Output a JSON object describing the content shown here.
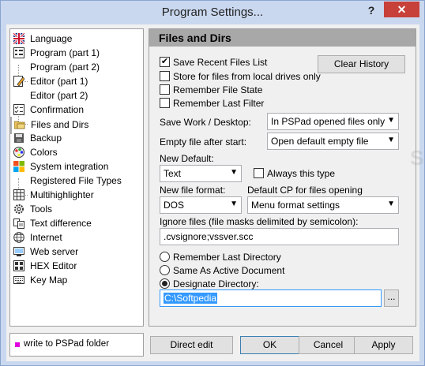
{
  "window": {
    "title": "Program Settings...",
    "help": "?",
    "close": "✕"
  },
  "tree": {
    "items": [
      {
        "label": "Language",
        "icon": "uk-flag-icon"
      },
      {
        "label": "Program  (part 1)",
        "icon": "form-icon"
      },
      {
        "label": "Program  (part 2)",
        "icon": ""
      },
      {
        "label": "Editor  (part 1)",
        "icon": "pencil-icon"
      },
      {
        "label": "Editor  (part 2)",
        "icon": ""
      },
      {
        "label": "Confirmation",
        "icon": "checklist-icon"
      },
      {
        "label": "Files and Dirs",
        "icon": "folder-icon"
      },
      {
        "label": "Backup",
        "icon": "backup-icon"
      },
      {
        "label": "Colors",
        "icon": "palette-icon"
      },
      {
        "label": "System integration",
        "icon": "windows-icon"
      },
      {
        "label": "Registered File Types",
        "icon": ""
      },
      {
        "label": "Multihighlighter",
        "icon": "grid-icon"
      },
      {
        "label": "Tools",
        "icon": "gear-icon"
      },
      {
        "label": "Text difference",
        "icon": "diff-icon"
      },
      {
        "label": "Internet",
        "icon": "globe-icon"
      },
      {
        "label": "Web server",
        "icon": "server-icon"
      },
      {
        "label": "HEX Editor",
        "icon": "hex-icon"
      },
      {
        "label": "Key Map",
        "icon": "keyboard-icon"
      }
    ]
  },
  "legend": {
    "text": "write to PSPad folder",
    "color": "#e000e0"
  },
  "panel": {
    "heading": "Files and Dirs",
    "checks": [
      {
        "label": "Save Recent Files List",
        "checked": "✔"
      },
      {
        "label": "Store for files from local drives only",
        "checked": ""
      },
      {
        "label": "Remember File State",
        "checked": ""
      },
      {
        "label": "Remember Last Filter",
        "checked": ""
      }
    ],
    "clear_history": "Clear History",
    "save_work_label": "Save Work / Desktop:",
    "save_work_value": "In PSPad opened files only",
    "empty_file_label": "Empty file after start:",
    "empty_file_value": "Open default empty file",
    "new_default_label": "New Default:",
    "new_default_value": "Text",
    "always_type": "Always this type",
    "new_format_label": "New file format:",
    "new_format_value": "DOS",
    "default_cp_label": "Default CP for files opening",
    "default_cp_value": "Menu format settings",
    "ignore_label": "Ignore files (file masks delimited by semicolon):",
    "ignore_value": ".cvsignore;vssver.scc",
    "radios": [
      {
        "label": "Remember Last Directory",
        "selected": false
      },
      {
        "label": "Same As Active Document",
        "selected": false
      },
      {
        "label": "Designate Directory:",
        "selected": true
      }
    ],
    "dir_value": "C:\\Softpedia",
    "browse": "..."
  },
  "buttons": {
    "direct_edit": "Direct edit",
    "ok": "OK",
    "cancel": "Cancel",
    "apply": "Apply"
  }
}
